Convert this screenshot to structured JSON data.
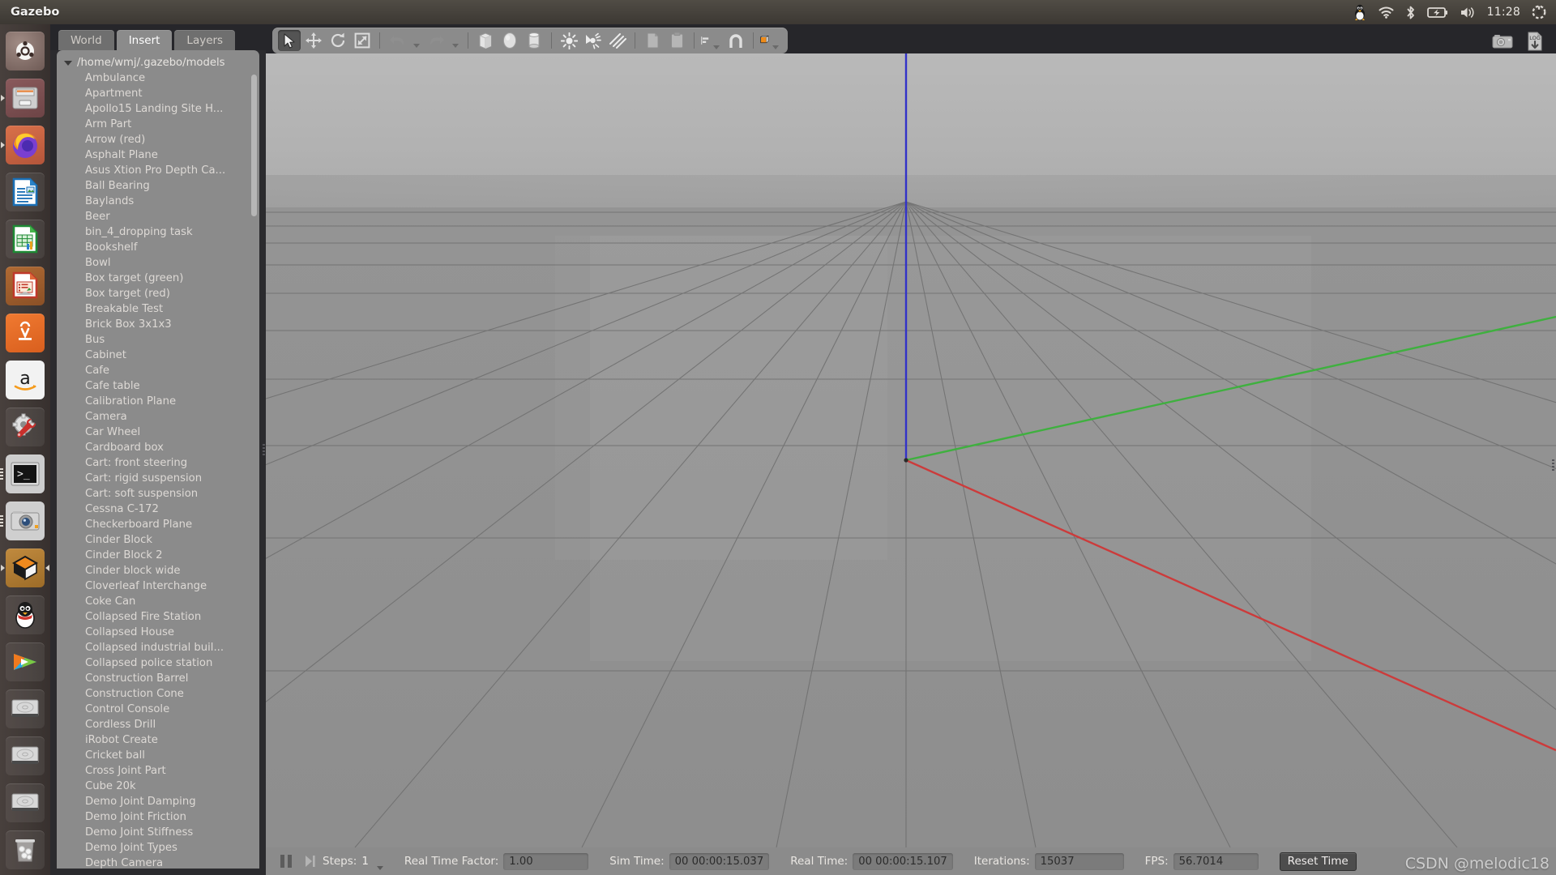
{
  "desktop": {
    "panel": {
      "app_title": "Gazebo",
      "tray": {
        "icons": [
          "linux-tux-icon",
          "wifi-icon",
          "bluetooth-icon",
          "battery-icon",
          "volume-icon"
        ],
        "clock": "11:28",
        "power_icon": "power-gear-icon"
      }
    },
    "launcher": {
      "items": [
        {
          "name": "ubuntu-dash",
          "label": "Ubuntu Dash",
          "running": false
        },
        {
          "name": "files",
          "label": "Files",
          "running": true
        },
        {
          "name": "firefox",
          "label": "Firefox",
          "running": true
        },
        {
          "name": "libreoffice-writer",
          "label": "LibreOffice Writer",
          "running": false
        },
        {
          "name": "libreoffice-calc",
          "label": "LibreOffice Calc",
          "running": false
        },
        {
          "name": "libreoffice-impress",
          "label": "LibreOffice Impress",
          "running": false
        },
        {
          "name": "ubuntu-software",
          "label": "Ubuntu Software",
          "running": false
        },
        {
          "name": "amazon",
          "label": "Amazon",
          "running": false
        },
        {
          "name": "system-settings",
          "label": "System Settings",
          "running": false
        },
        {
          "name": "terminal",
          "label": "Terminal",
          "running": true
        },
        {
          "name": "screenshot-camera",
          "label": "Screenshot",
          "running": true
        },
        {
          "name": "gazebo",
          "label": "Gazebo",
          "running": true
        },
        {
          "name": "qq",
          "label": "QQ",
          "running": false
        },
        {
          "name": "media-player",
          "label": "Media Player",
          "running": false
        },
        {
          "name": "disk-1",
          "label": "Disk",
          "running": false
        },
        {
          "name": "disk-2",
          "label": "Disk",
          "running": false
        },
        {
          "name": "disk-3",
          "label": "Disk",
          "running": false
        },
        {
          "name": "trash",
          "label": "Trash",
          "running": false
        }
      ]
    }
  },
  "left_panel": {
    "tabs": [
      {
        "label": "World",
        "active": false
      },
      {
        "label": "Insert",
        "active": true
      },
      {
        "label": "Layers",
        "active": false
      }
    ],
    "tree_root": "/home/wmj/.gazebo/models",
    "models": [
      "Ambulance",
      "Apartment",
      "Apollo15 Landing Site H...",
      "Arm Part",
      "Arrow (red)",
      "Asphalt Plane",
      "Asus Xtion Pro Depth Ca...",
      "Ball Bearing",
      "Baylands",
      "Beer",
      "bin_4_dropping task",
      "Bookshelf",
      "Bowl",
      "Box target (green)",
      "Box target (red)",
      "Breakable Test",
      "Brick Box 3x1x3",
      "Bus",
      "Cabinet",
      "Cafe",
      "Cafe table",
      "Calibration Plane",
      "Camera",
      "Car Wheel",
      "Cardboard box",
      "Cart: front steering",
      "Cart: rigid suspension",
      "Cart: soft suspension",
      "Cessna C-172",
      "Checkerboard Plane",
      "Cinder Block",
      "Cinder Block 2",
      "Cinder block wide",
      "Cloverleaf Interchange",
      "Coke Can",
      "Collapsed Fire Station",
      "Collapsed House",
      "Collapsed industrial buil...",
      "Collapsed police station",
      "Construction Barrel",
      "Construction Cone",
      "Control Console",
      "Cordless Drill",
      "iRobot Create",
      "Cricket ball",
      "Cross Joint Part",
      "Cube 20k",
      "Demo Joint Damping",
      "Demo Joint Friction",
      "Demo Joint Stiffness",
      "Demo Joint Types",
      "Depth Camera"
    ]
  },
  "toolbar": {
    "tools": [
      {
        "name": "select-mode-icon",
        "label": "Selection Mode",
        "selected": true
      },
      {
        "name": "translate-mode-icon",
        "label": "Translation Mode",
        "selected": false
      },
      {
        "name": "rotate-mode-icon",
        "label": "Rotation Mode",
        "selected": false
      },
      {
        "name": "scale-mode-icon",
        "label": "Scale Mode",
        "selected": false
      },
      {
        "name": "undo-icon",
        "label": "Undo",
        "selected": false
      },
      {
        "name": "redo-icon",
        "label": "Redo",
        "selected": false
      },
      {
        "name": "box-icon",
        "label": "Box",
        "selected": false
      },
      {
        "name": "sphere-icon",
        "label": "Sphere",
        "selected": false
      },
      {
        "name": "cylinder-icon",
        "label": "Cylinder",
        "selected": false
      },
      {
        "name": "point-light-icon",
        "label": "Point Light",
        "selected": false
      },
      {
        "name": "spot-light-icon",
        "label": "Spot Light",
        "selected": false
      },
      {
        "name": "directional-light-icon",
        "label": "Directional Light",
        "selected": false
      },
      {
        "name": "copy-icon",
        "label": "Copy",
        "selected": false
      },
      {
        "name": "paste-icon",
        "label": "Paste",
        "selected": false
      },
      {
        "name": "align-icon",
        "label": "Align",
        "selected": false
      },
      {
        "name": "snap-icon",
        "label": "Snap",
        "selected": false
      },
      {
        "name": "view-angle-icon",
        "label": "Change View Angle",
        "selected": false
      }
    ],
    "viewport_icons": [
      {
        "name": "screenshot-icon",
        "label": "Save Screenshot"
      },
      {
        "name": "log-record-icon",
        "label": "Log Data",
        "text": "LOG"
      }
    ]
  },
  "status_bar": {
    "play_pause_icon": "pause-icon",
    "step_icon": "step-forward-icon",
    "steps_label": "Steps:",
    "steps_value": "1",
    "real_time_factor_label": "Real Time Factor:",
    "real_time_factor_value": "1.00",
    "sim_time_label": "Sim Time:",
    "sim_time_value": "00 00:00:15.037",
    "real_time_label": "Real Time:",
    "real_time_value": "00 00:00:15.107",
    "iterations_label": "Iterations:",
    "iterations_value": "15037",
    "fps_label": "FPS:",
    "fps_value": "56.7014",
    "reset_button": "Reset Time"
  },
  "viewport": {
    "axes": {
      "x_axis_color": "#cc3b3b",
      "y_axis_color": "#3fb03f",
      "z_axis_color": "#3232c8"
    },
    "grid": true,
    "background_color": "#9a9a9a"
  },
  "watermark": "CSDN @melodic18"
}
